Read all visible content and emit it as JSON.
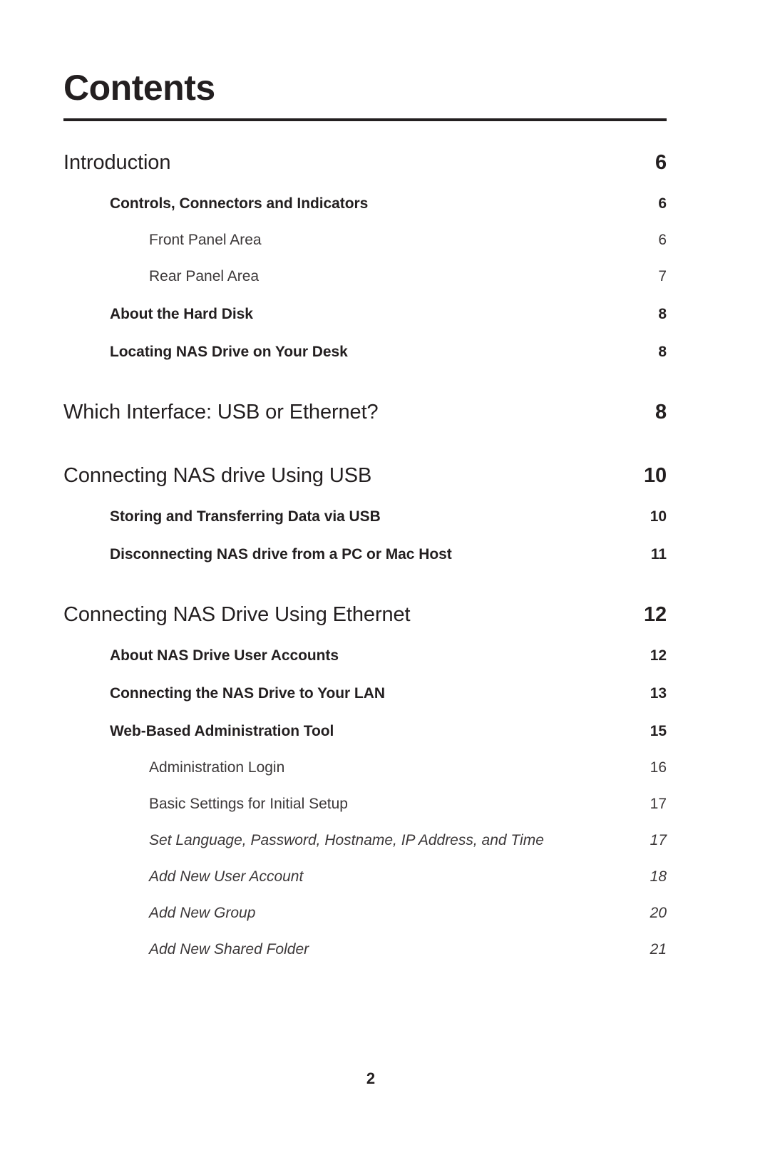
{
  "document": {
    "title": "Contents",
    "folio": "2"
  },
  "toc": {
    "entries": [
      {
        "level": 1,
        "label": "Introduction",
        "page": "6"
      },
      {
        "level": 2,
        "label": "Controls, Connectors and Indicators",
        "page": "6"
      },
      {
        "level": 3,
        "label": "Front Panel Area",
        "page": "6"
      },
      {
        "level": 3,
        "label": "Rear Panel Area",
        "page": "7"
      },
      {
        "level": 2,
        "label": "About the Hard Disk",
        "page": "8"
      },
      {
        "level": 2,
        "label": "Locating NAS Drive on Your Desk",
        "page": "8"
      },
      {
        "level": 1,
        "label": "Which Interface: USB or Ethernet?",
        "page": "8"
      },
      {
        "level": 1,
        "label": "Connecting NAS drive Using USB",
        "page": "10"
      },
      {
        "level": 2,
        "label": "Storing and Transferring Data via USB",
        "page": "10"
      },
      {
        "level": 2,
        "label": "Disconnecting NAS drive from a PC or Mac Host",
        "page": "11"
      },
      {
        "level": 1,
        "label": "Connecting NAS Drive Using Ethernet",
        "page": "12"
      },
      {
        "level": 2,
        "label": "About NAS Drive User Accounts",
        "page": "12"
      },
      {
        "level": 2,
        "label": "Connecting the NAS Drive to Your LAN",
        "page": "13"
      },
      {
        "level": 2,
        "label": "Web-Based Administration Tool",
        "page": "15"
      },
      {
        "level": 3,
        "label": "Administration Login",
        "page": "16"
      },
      {
        "level": 3,
        "label": "Basic Settings for Initial Setup",
        "page": "17"
      },
      {
        "level": 4,
        "label": "Set Language, Password, Hostname, IP Address, and Time",
        "page": "17"
      },
      {
        "level": 4,
        "label": "Add New User Account",
        "page": "18"
      },
      {
        "level": 4,
        "label": "Add New Group",
        "page": "20"
      },
      {
        "level": 4,
        "label": "Add New Shared Folder",
        "page": "21"
      }
    ]
  },
  "colors": {
    "ink": "#231f20",
    "ink_light": "#3b3738",
    "background": "#ffffff"
  }
}
